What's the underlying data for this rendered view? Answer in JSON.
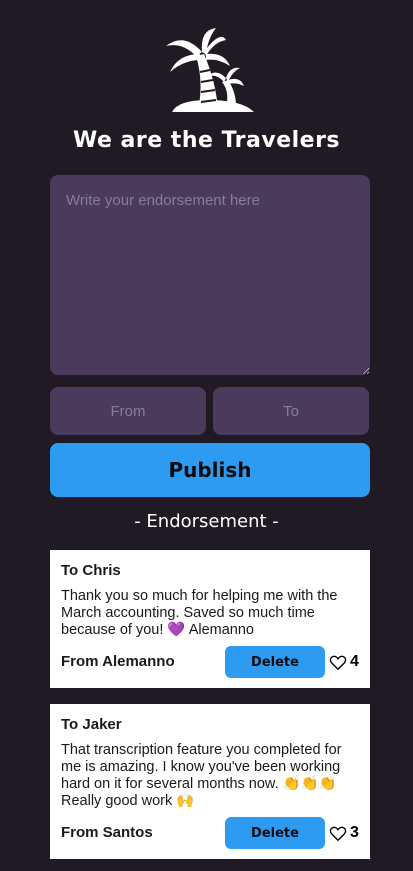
{
  "app": {
    "title": "We are the Travelers"
  },
  "form": {
    "message_placeholder": "Write your endorsement here",
    "from_placeholder": "From",
    "to_placeholder": "To",
    "publish_label": "Publish"
  },
  "section": {
    "title": "- Endorsement -"
  },
  "endorsements": [
    {
      "to": "To Chris",
      "message": "Thank you so much for helping me with the March accounting. Saved so much time because of you! 💜 Alemanno",
      "from": "From Alemanno",
      "delete_label": "Delete",
      "likes": "4"
    },
    {
      "to": "To Jaker",
      "message": "That transcription feature you completed for me is amazing. I know you've been working hard on it for several months now. 👏👏👏 Really good work 🙌",
      "from": "From Santos",
      "delete_label": "Delete",
      "likes": "3"
    }
  ],
  "icons": {
    "logo": "palm-trees-island-icon",
    "like": "heart-outline-icon"
  },
  "colors": {
    "background": "#1f1a24",
    "input": "#4a3b5c",
    "accent": "#2e9bf2",
    "card": "#ffffff"
  }
}
